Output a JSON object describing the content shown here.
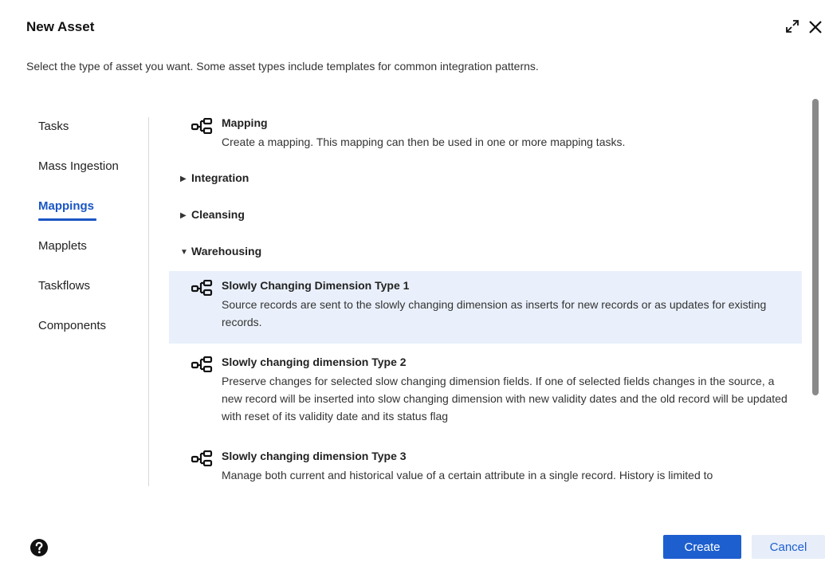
{
  "dialog": {
    "title": "New Asset",
    "subtitle": "Select the type of asset you want. Some asset types include templates for common integration patterns."
  },
  "nav": {
    "items": [
      {
        "label": "Tasks"
      },
      {
        "label": "Mass Ingestion"
      },
      {
        "label": "Mappings",
        "active": true
      },
      {
        "label": "Mapplets"
      },
      {
        "label": "Taskflows"
      },
      {
        "label": "Components"
      }
    ]
  },
  "content": {
    "mapping": {
      "title": "Mapping",
      "description": "Create a mapping. This mapping can then be used in one or more mapping tasks.",
      "icon": "mapping-icon"
    },
    "groups": {
      "integration": {
        "label": "Integration",
        "expanded": false
      },
      "cleansing": {
        "label": "Cleansing",
        "expanded": false
      },
      "warehousing": {
        "label": "Warehousing",
        "expanded": true
      }
    },
    "warehousing_items": [
      {
        "title": "Slowly Changing Dimension Type 1",
        "description": "Source records are sent to the slowly changing dimension as inserts for new records or as updates for existing records.",
        "selected": true
      },
      {
        "title": "Slowly changing dimension Type 2",
        "description": "Preserve changes for selected slow changing dimension fields. If one of selected fields changes in the source, a new record will be inserted into slow changing dimension with new validity dates and the old record will be updated with reset of its validity date and its status flag"
      },
      {
        "title": "Slowly changing dimension Type 3",
        "description": "Manage both current and historical value of a certain attribute in a single record. History is limited to"
      }
    ]
  },
  "footer": {
    "create_label": "Create",
    "cancel_label": "Cancel"
  },
  "colors": {
    "accent": "#1e5fcf",
    "selected_bg": "#e9f0fb",
    "cancel_bg": "#e7eef9"
  }
}
